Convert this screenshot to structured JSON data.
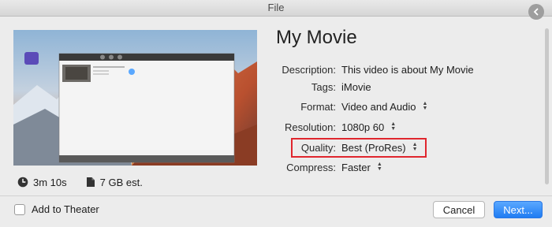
{
  "window": {
    "title": "File"
  },
  "movie": {
    "title": "My Movie",
    "duration": "3m 10s",
    "size_estimate": "7 GB est."
  },
  "properties": [
    {
      "label": "Description:",
      "value": "This video is about My Movie",
      "has_stepper": false
    },
    {
      "label": "Tags:",
      "value": "iMovie",
      "has_stepper": false
    },
    {
      "label": "Format:",
      "value": "Video and Audio",
      "has_stepper": true
    },
    {
      "label": "Resolution:",
      "value": "1080p 60",
      "has_stepper": true
    },
    {
      "label": "Quality:",
      "value": "Best (ProRes)",
      "has_stepper": true
    },
    {
      "label": "Compress:",
      "value": "Faster",
      "has_stepper": true
    }
  ],
  "footer": {
    "add_to_theater_label": "Add to Theater",
    "add_to_theater_checked": false,
    "cancel_label": "Cancel",
    "next_label": "Next..."
  },
  "colors": {
    "highlight": "#e0262e",
    "primary_button": "#1f7cf2"
  }
}
